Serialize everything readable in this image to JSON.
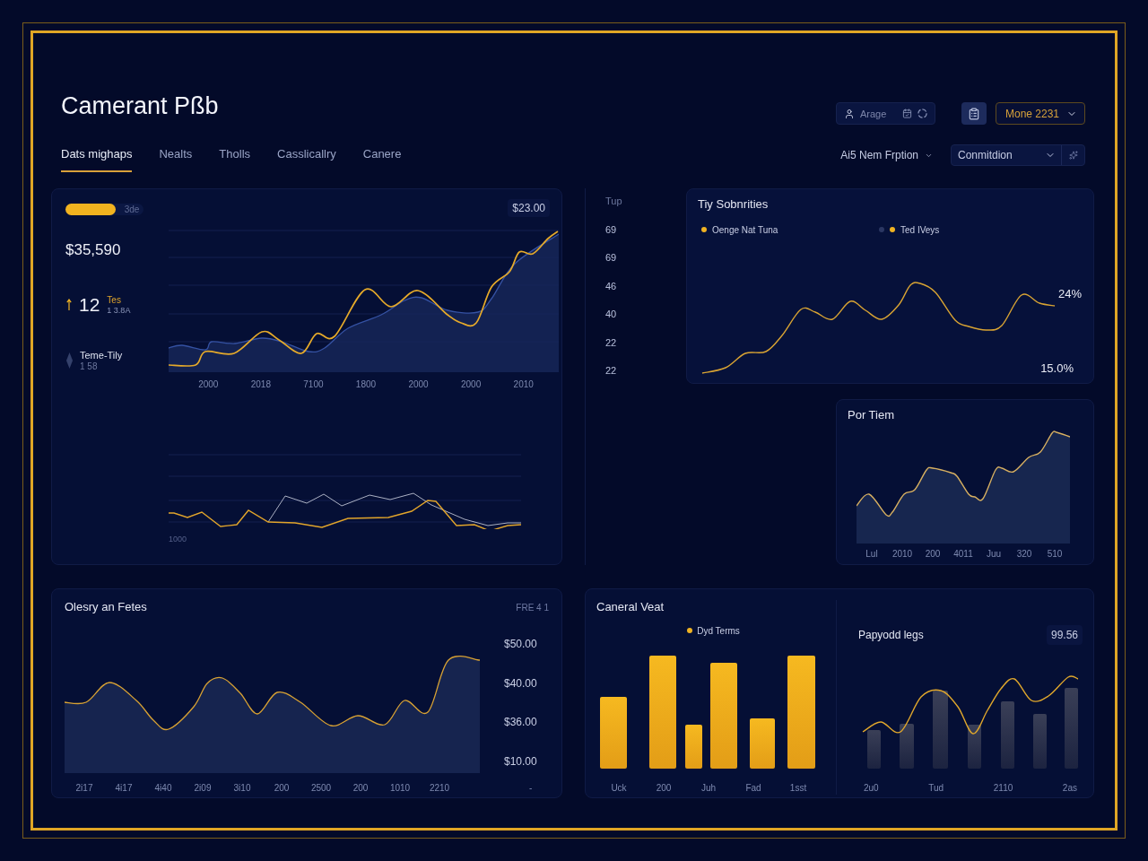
{
  "header": {
    "title": "Camerant Pßb",
    "tabs": [
      {
        "label": "Dats mighaps",
        "selected": true
      },
      {
        "label": "Nealts",
        "selected": false
      },
      {
        "label": "Tholls",
        "selected": false
      },
      {
        "label": "Casslicallry",
        "selected": false
      },
      {
        "label": "Canere",
        "selected": false
      }
    ],
    "search": {
      "placeholder": "Arage"
    },
    "period_dropdown": {
      "value": "Mone 2231"
    },
    "filter_menu": {
      "label": "Ai5 Nem Frption"
    },
    "condition_select": {
      "value": "Conmitdion"
    }
  },
  "overview_panel": {
    "progress": {
      "level": 0.64,
      "label": "3de"
    },
    "total": "$35,590",
    "count": {
      "value": "12",
      "label": "Tes",
      "detail": "1 3.8A"
    },
    "metric": {
      "label": "Teme-Tily",
      "value": "1 58"
    },
    "badge": "$23.00",
    "x_labels": [
      "2000",
      "2018",
      "7100",
      "1800",
      "2000",
      "2000",
      "2010"
    ],
    "lower_chart_label": "1000"
  },
  "axis_labels": [
    "Tup",
    "69",
    "69",
    "46",
    "40",
    "22",
    "22"
  ],
  "trend_panel": {
    "title": "Tiy Sobnrities",
    "legend": [
      {
        "label": "Oenge Nat Tuna",
        "color": "#f0b323"
      },
      {
        "color": "#2b3763"
      },
      {
        "label": "Ted IVeys",
        "color": "#f0b323"
      }
    ],
    "high_label": "24%",
    "low_label": "15.0%"
  },
  "per_item_panel": {
    "title": "Por Tiem",
    "x_labels": [
      "Lul",
      "2010",
      "200",
      "4011",
      "Juu",
      "320",
      "510"
    ]
  },
  "rates_panel": {
    "title": "Olesry an Fetes",
    "tag": "FRE 4 1",
    "y_labels": [
      "$50.00",
      "$40.00",
      "$36.00",
      "$10.00"
    ],
    "x_labels": [
      "2i17",
      "4i17",
      "4i40",
      "2i09",
      "3i10",
      "200",
      "2500",
      "200",
      "1010",
      "2210"
    ],
    "axis_end": "-"
  },
  "volume_panel": {
    "title": "Caneral Veat",
    "legend": "Dyd Terms",
    "x_labels": [
      "Uck",
      "200",
      "Juh",
      "Fad",
      "1sst"
    ]
  },
  "payload_panel": {
    "title": "Papyodd legs",
    "badge": "99.56",
    "x_labels": [
      "2u0",
      "Tud",
      "2110",
      "2as"
    ]
  }
}
